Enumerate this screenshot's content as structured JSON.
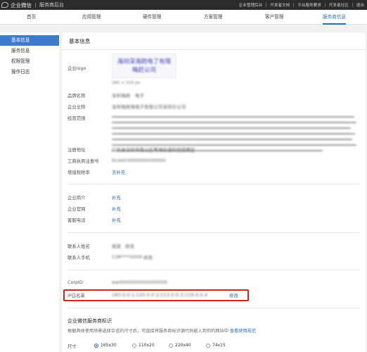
{
  "app": {
    "brand_name": "企业微信",
    "subtitle": "服务商后台",
    "top_links": [
      "企业管理后台",
      "开发者文档",
      "平台服务要求",
      "开发者社区",
      "退出"
    ]
  },
  "nav": {
    "tabs": [
      "首页",
      "应用管理",
      "硬件管理",
      "方案管理",
      "客户管理",
      "服务商信息"
    ],
    "active": "服务商信息"
  },
  "sidebar": {
    "items": [
      "基本信息",
      "服务信息",
      "权限管理",
      "操作日志"
    ],
    "active": "基本信息"
  },
  "main": {
    "title": "基本信息",
    "logo": {
      "label": "企业logo",
      "line1": "海圳深海跨电了有限",
      "line2": "晦赶公司",
      "size_note": "160 × 210 px"
    },
    "company": {
      "brand_label": "品牌名称",
      "brand_value": "深圳海跨 · 电子",
      "fullname_label": "企业全称",
      "fullname_value": "深圳海跨海电子有限公司深圳分公司",
      "scope_label": "经营范围",
      "reg_address_label": "注册地址",
      "reg_address_value": "广东省深圳市南山区粤海街道科技园南区",
      "license_label": "工商执照注册号",
      "license_value": "914403000000000000",
      "vat_label": "增值税税率",
      "vat_link": "去补充"
    },
    "profile": {
      "intro_label": "企业简介",
      "intro_link": "补充",
      "site_label": "企业官网",
      "site_link": "补充",
      "phone_label": "客服电话",
      "phone_link": "补充"
    },
    "contact": {
      "name_label": "联系人姓名",
      "name_value": "谢某",
      "name_link": "修改",
      "phone_label": "联系人手机",
      "phone_value": "138****0000",
      "phone_link": "修改"
    },
    "corp": {
      "corpid_label": "CorpID",
      "corpid_value": "ww0000000000000000",
      "ip_label": "IP白名单",
      "ip_value": "183.0.0.1;120.0.0.2;113.0.0.3;119.0.0.4",
      "ip_link": "修改"
    },
    "badge": {
      "title": "企业微信服务商标识",
      "desc": "根据具体使用场景选择合适的尺寸后，可直接将服务商标识源代码嵌入到你的网站中",
      "desc_link": "查看使用规范",
      "size_label": "尺寸",
      "options": [
        "165x30",
        "110x20",
        "220x40",
        "74x15"
      ],
      "selected": "165x30"
    }
  }
}
